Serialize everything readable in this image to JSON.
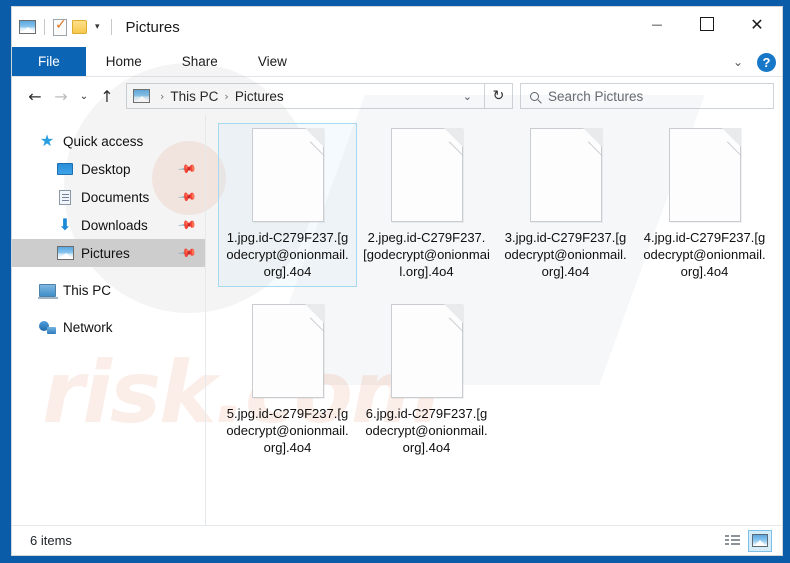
{
  "window": {
    "title": "Pictures",
    "quick_access_toolbar": [
      {
        "name": "picture-icon",
        "label": "Pictures"
      },
      {
        "name": "properties-icon",
        "label": "Properties"
      },
      {
        "name": "new-folder-icon",
        "label": "New folder"
      },
      {
        "name": "customize-chevron-icon",
        "label": "Customize Quick Access Toolbar"
      }
    ],
    "controls": {
      "minimize": "Minimize",
      "maximize": "Maximize",
      "close": "Close"
    }
  },
  "ribbon": {
    "tabs": [
      {
        "label": "File",
        "active": true
      },
      {
        "label": "Home",
        "active": false
      },
      {
        "label": "Share",
        "active": false
      },
      {
        "label": "View",
        "active": false
      }
    ],
    "expand_label": "Expand the Ribbon",
    "help_label": "?"
  },
  "navbar": {
    "back": "←",
    "forward": "→",
    "recent": "⌄",
    "up": "↑",
    "breadcrumb": {
      "icon": "picture-icon",
      "parts": [
        "This PC",
        "Pictures"
      ],
      "separator": "›"
    },
    "address_chevron": "⌄",
    "refresh": "↻"
  },
  "search": {
    "placeholder": "Search Pictures",
    "icon": "search-icon"
  },
  "sidebar": {
    "items": [
      {
        "label": "Quick access",
        "icon": "star-icon",
        "level": 0,
        "pinned": false,
        "selected": false
      },
      {
        "label": "Desktop",
        "icon": "desktop-icon",
        "level": 1,
        "pinned": true,
        "selected": false
      },
      {
        "label": "Documents",
        "icon": "documents-icon",
        "level": 1,
        "pinned": true,
        "selected": false
      },
      {
        "label": "Downloads",
        "icon": "downloads-icon",
        "level": 1,
        "pinned": true,
        "selected": false
      },
      {
        "label": "Pictures",
        "icon": "pictures-icon",
        "level": 1,
        "pinned": true,
        "selected": true
      },
      {
        "label": "This PC",
        "icon": "this-pc-icon",
        "level": 0,
        "pinned": false,
        "selected": false
      },
      {
        "label": "Network",
        "icon": "network-icon",
        "level": 0,
        "pinned": false,
        "selected": false
      }
    ],
    "pin_glyph": "📌"
  },
  "files": [
    {
      "name": "1.jpg.id-C279F237.[godecrypt@onionmail.org].4o4",
      "selected": true
    },
    {
      "name": "2.jpeg.id-C279F237.[godecrypt@onionmail.org].4o4",
      "selected": false
    },
    {
      "name": "3.jpg.id-C279F237.[godecrypt@onionmail.org].4o4",
      "selected": false
    },
    {
      "name": "4.jpg.id-C279F237.[godecrypt@onionmail.org].4o4",
      "selected": false
    },
    {
      "name": "5.jpg.id-C279F237.[godecrypt@onionmail.org].4o4",
      "selected": false
    },
    {
      "name": "6.jpg.id-C279F237.[godecrypt@onionmail.org].4o4",
      "selected": false
    }
  ],
  "statusbar": {
    "item_count": "6 items",
    "views": [
      {
        "name": "details-view",
        "active": false
      },
      {
        "name": "large-icons-view",
        "active": true
      }
    ]
  },
  "watermark": {
    "text": "risk.com"
  },
  "colors": {
    "window_border": "#0a5ca8",
    "file_tab": "#0c64b4",
    "selection": "#a6d8ef",
    "sidebar_selected": "#cdcdcd",
    "accent": "#1878c8"
  }
}
